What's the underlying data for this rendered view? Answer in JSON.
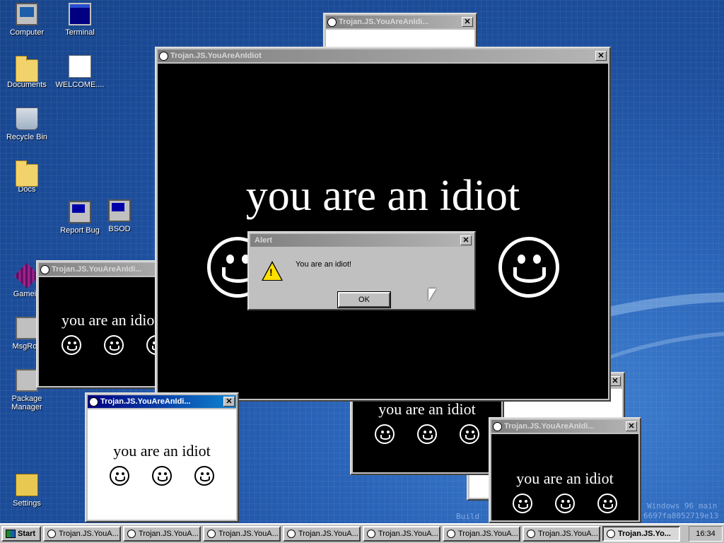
{
  "desktop": {
    "icons": [
      {
        "label": "Computer",
        "glyph": "computer-icon"
      },
      {
        "label": "Terminal",
        "glyph": "terminal-icon"
      },
      {
        "label": "Documents",
        "glyph": "folder-icon"
      },
      {
        "label": "WELCOME....",
        "glyph": "document-icon"
      },
      {
        "label": "Recycle Bin",
        "glyph": "recycle-bin-icon"
      },
      {
        "label": "Docs",
        "glyph": "folder-icon"
      },
      {
        "label": "Report Bug",
        "glyph": "computer-icon"
      },
      {
        "label": "BSOD",
        "glyph": "computer-icon"
      },
      {
        "label": "Gamein",
        "glyph": "game-icon"
      },
      {
        "label": "MsgRoo",
        "glyph": "message-icon"
      },
      {
        "label": "Package Manager",
        "glyph": "package-icon"
      },
      {
        "label": "Settings",
        "glyph": "settings-icon"
      }
    ],
    "build_text": "Build",
    "watermark_line1": "Windows 96 main",
    "watermark_line2": "6697fa8052719e13"
  },
  "windows": {
    "title_full": "Trojan.JS.YouAreAnIdiot",
    "title_short": "Trojan.JS.YouAreAnIdi...",
    "message": "you are an idiot"
  },
  "alert": {
    "title": "Alert",
    "text": "You are an idiot!",
    "ok_label": "OK"
  },
  "taskbar": {
    "start_label": "Start",
    "app_label": "Trojan.JS.YouA...",
    "active_label": "Trojan.JS.Yo...",
    "clock": "16:34"
  },
  "colors": {
    "titlebar_active": "#000080",
    "titlebar_inactive": "#808080",
    "window_face": "#c0c0c0"
  }
}
